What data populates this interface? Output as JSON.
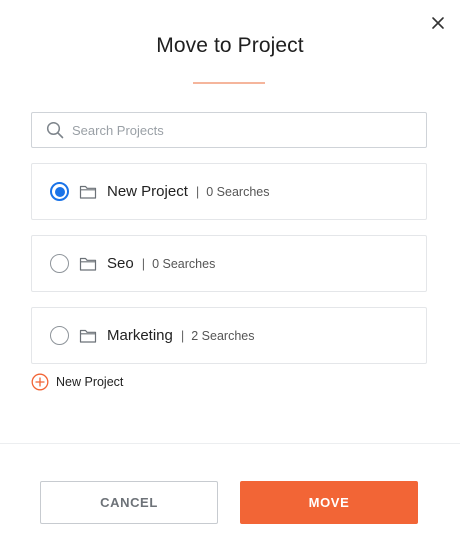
{
  "dialog": {
    "title": "Move to Project",
    "close_icon": "close-icon",
    "accent_color": "#f26536"
  },
  "search": {
    "placeholder": "Search Projects",
    "value": ""
  },
  "projects": [
    {
      "name": "New Project",
      "separator": "|",
      "count": "0 Searches",
      "selected": true
    },
    {
      "name": "Seo",
      "separator": "|",
      "count": "0 Searches",
      "selected": false
    },
    {
      "name": "Marketing",
      "separator": "|",
      "count": "2 Searches",
      "selected": false
    }
  ],
  "new_project": {
    "label": "New Project",
    "icon": "plus-circle-icon"
  },
  "footer": {
    "cancel_label": "CANCEL",
    "move_label": "MOVE"
  }
}
